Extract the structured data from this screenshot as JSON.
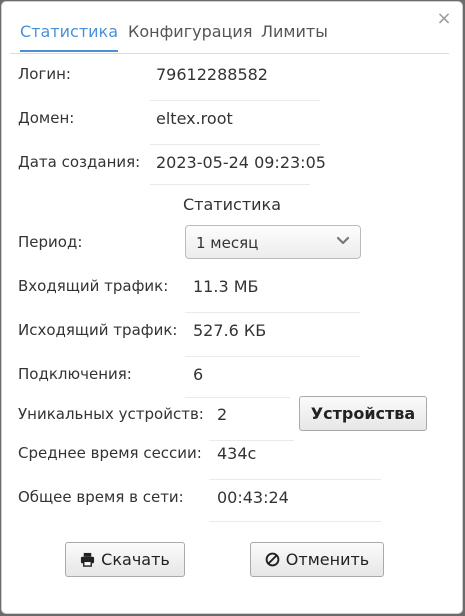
{
  "tabs": [
    {
      "label": "Статистика",
      "active": true
    },
    {
      "label": "Конфигурация",
      "active": false
    },
    {
      "label": "Лимиты",
      "active": false
    }
  ],
  "close_icon": "×",
  "info": {
    "login_label": "Логин:",
    "login_value": "79612288582",
    "domain_label": "Домен:",
    "domain_value": "eltex.root",
    "created_label": "Дата создания:",
    "created_value": "2023-05-24 09:23:05"
  },
  "stats": {
    "title": "Статистика",
    "period_label": "Период:",
    "period_value": "1 месяц",
    "incoming_label": "Входящий трафик:",
    "incoming_value": "11.3 МБ",
    "outgoing_label": "Исходящий трафик:",
    "outgoing_value": "527.6 КБ",
    "connections_label": "Подключения:",
    "connections_value": "6",
    "unique_devices_label": "Уникальных устройств:",
    "unique_devices_value": "2",
    "devices_button": "Устройства",
    "avg_session_label": "Среднее время сессии:",
    "avg_session_value": "434с",
    "total_time_label": "Общее время в сети:",
    "total_time_value": "00:43:24"
  },
  "actions": {
    "download_label": "Скачать",
    "cancel_label": "Отменить"
  },
  "colors": {
    "accent": "#4a90d9",
    "overlay": "#6b6b6b"
  }
}
